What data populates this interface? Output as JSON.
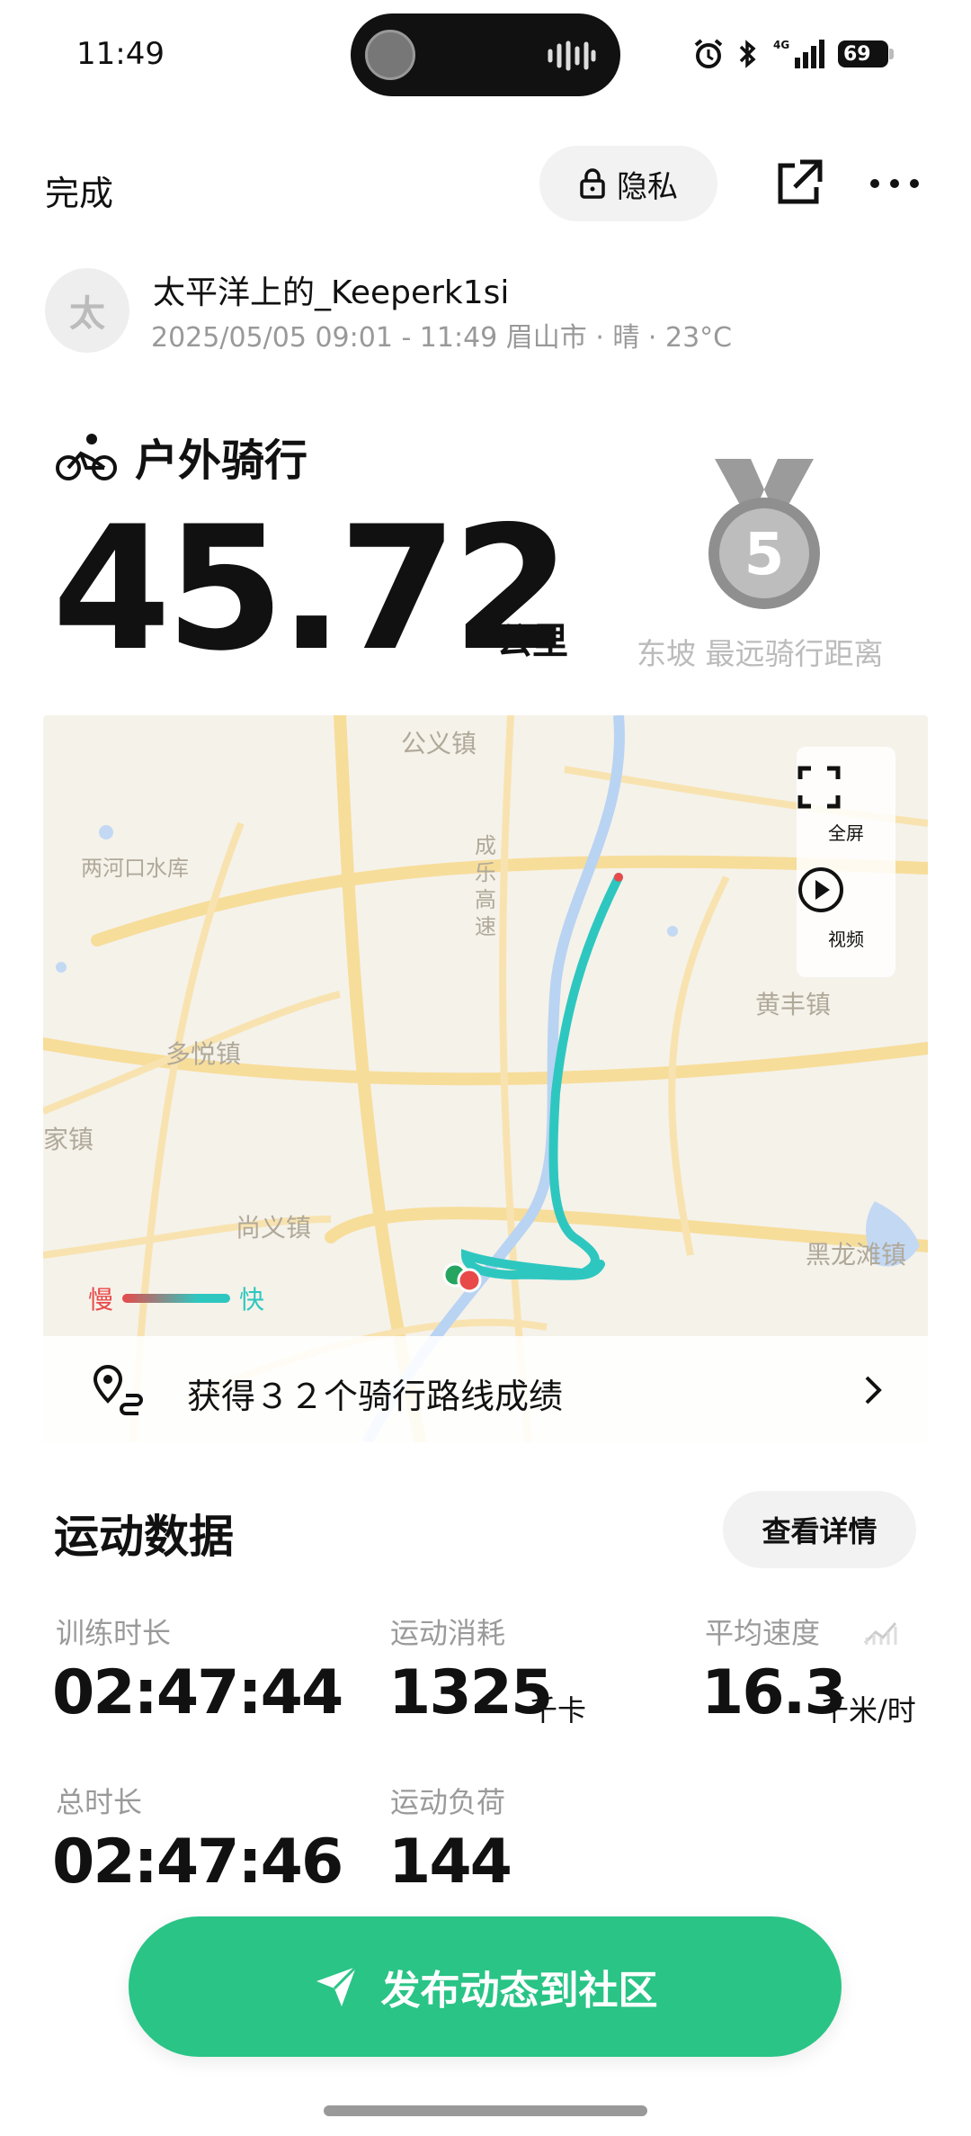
{
  "status_bar": {
    "time": "11:49",
    "battery": "69",
    "network": "4G"
  },
  "top_bar": {
    "done_label": "完成",
    "privacy_label": "隐私"
  },
  "user": {
    "avatar_text": "太",
    "name": "太平洋上的_Keeperk1si",
    "meta": "2025/05/05 09:01 - 11:49 眉山市 · 晴 · 23°C"
  },
  "workout": {
    "type": "户外骑行",
    "distance": "45.72",
    "unit": "公里"
  },
  "medal": {
    "number": "5",
    "label": "东坡 最远骑行距离"
  },
  "map": {
    "labels": [
      "公义镇",
      "成乐高速",
      "两河口水库",
      "黄丰镇",
      "多悦镇",
      "家镇",
      "尚义镇",
      "黑龙滩镇"
    ],
    "controls": {
      "fullscreen": "全屏",
      "video": "视频"
    },
    "legend": {
      "slow": "慢",
      "fast": "快"
    },
    "achievement": "获得３２个骑行路线成绩"
  },
  "stats": {
    "title": "运动数据",
    "detail_button": "查看详情",
    "items": [
      {
        "label": "训练时长",
        "value": "02:47:44",
        "unit": ""
      },
      {
        "label": "运动消耗",
        "value": "1325",
        "unit": "千卡"
      },
      {
        "label": "平均速度",
        "value": "16.3",
        "unit": "千米/时"
      },
      {
        "label": "总时长",
        "value": "02:47:46",
        "unit": ""
      },
      {
        "label": "运动负荷",
        "value": "144",
        "unit": ""
      }
    ]
  },
  "publish_button": "发布动态到社区",
  "colors": {
    "accent": "#29c486",
    "route": "#2ec7c0",
    "slow": "#e84a4a"
  }
}
